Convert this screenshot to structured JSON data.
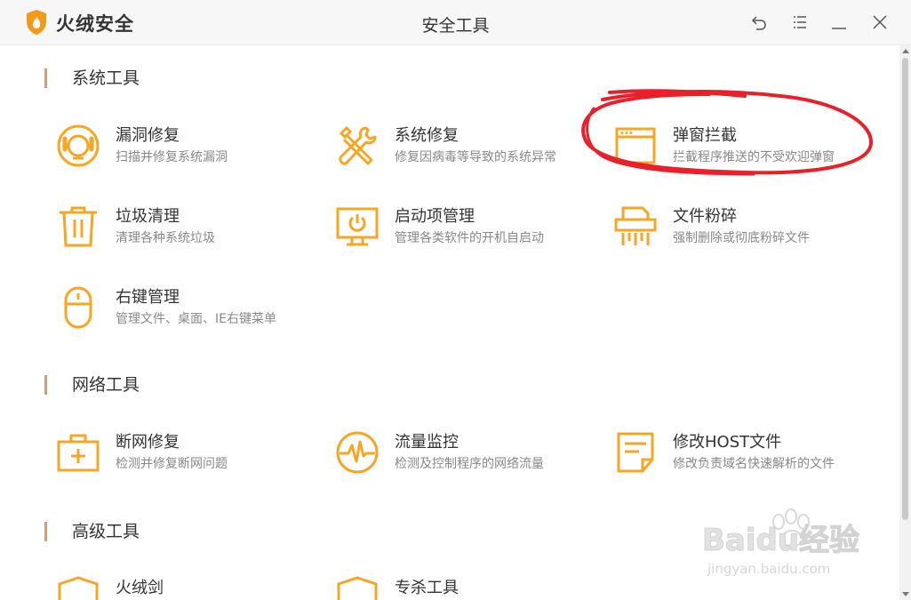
{
  "window": {
    "brand": "火绒安全",
    "title": "安全工具"
  },
  "sections": [
    {
      "title": "系统工具"
    },
    {
      "title": "网络工具"
    },
    {
      "title": "高级工具"
    }
  ],
  "tools": {
    "vuln": {
      "name": "漏洞修复",
      "desc": "扫描并修复系统漏洞",
      "icon": "lifebuoy-icon"
    },
    "sysrepair": {
      "name": "系统修复",
      "desc": "修复因病毒等导致的系统异常",
      "icon": "wrench-screwdriver-icon"
    },
    "popup": {
      "name": "弹窗拦截",
      "desc": "拦截程序推送的不受欢迎弹窗",
      "icon": "browser-window-icon"
    },
    "trash": {
      "name": "垃圾清理",
      "desc": "清理各种系统垃圾",
      "icon": "trash-can-icon"
    },
    "startup": {
      "name": "启动项管理",
      "desc": "管理各类软件的开机自启动",
      "icon": "monitor-power-icon"
    },
    "shredder": {
      "name": "文件粉碎",
      "desc": "强制删除或彻底粉碎文件",
      "icon": "shredder-icon"
    },
    "rightclick": {
      "name": "右键管理",
      "desc": "管理文件、桌面、IE右键菜单",
      "icon": "mouse-icon"
    },
    "netrepair": {
      "name": "断网修复",
      "desc": "检测并修复断网问题",
      "icon": "medical-kit-icon"
    },
    "traffic": {
      "name": "流量监控",
      "desc": "检测及控制程序的网络流量",
      "icon": "pulse-icon"
    },
    "host": {
      "name": "修改HOST文件",
      "desc": "修改负责域名快速解析的文件",
      "icon": "document-edit-icon"
    },
    "firesword": {
      "name": "火绒剑",
      "icon": "shield-icon"
    },
    "special": {
      "name": "专杀工具",
      "icon": "shield-icon"
    }
  },
  "watermark": {
    "text": "Baidu经验",
    "url": "jingyan.baidu.com"
  },
  "colors": {
    "accent": "#f5a623",
    "annotation": "#e8202a",
    "section_bar": "#c6a27e"
  }
}
